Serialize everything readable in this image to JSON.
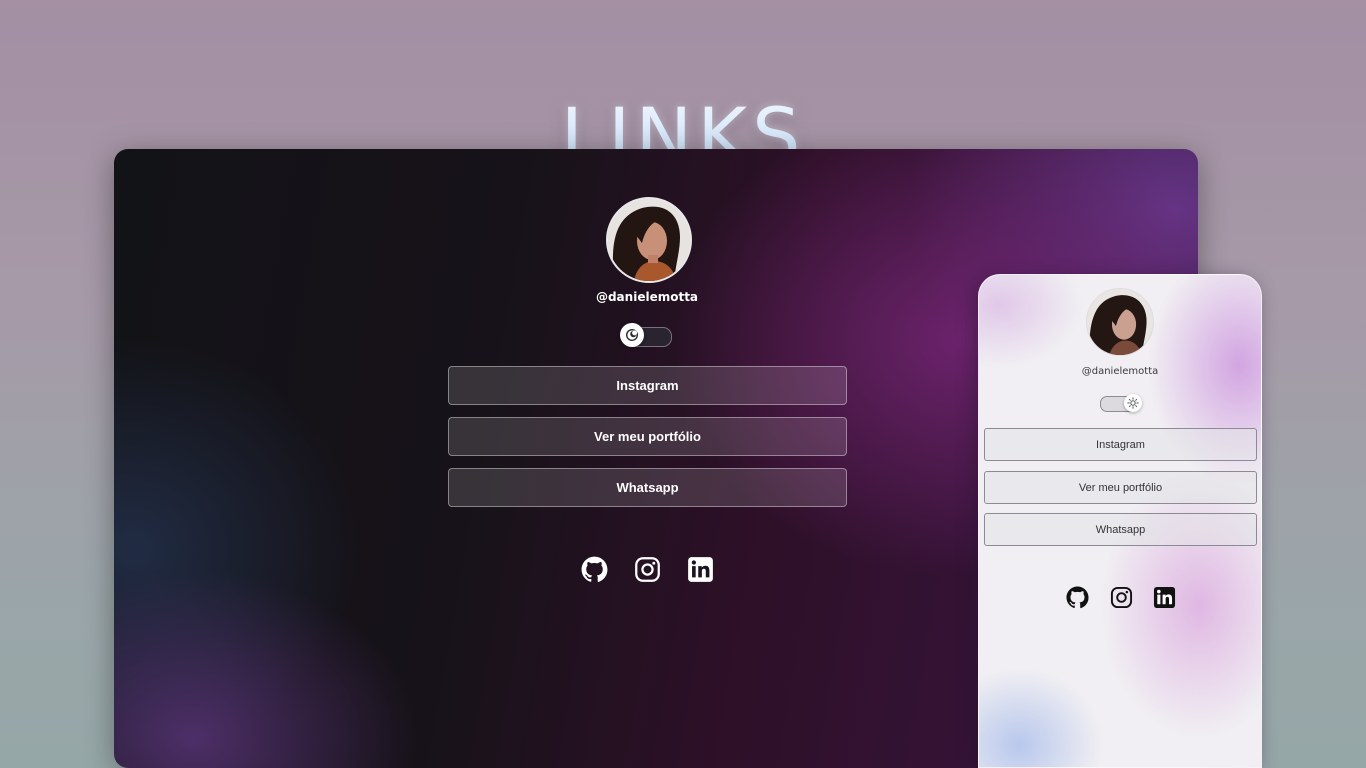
{
  "page": {
    "title": "LINKS"
  },
  "desktop": {
    "username": "@danielemotta",
    "theme_toggle": {
      "state": "dark",
      "knob_icon": "moon-icon"
    },
    "buttons": [
      {
        "label": "Instagram"
      },
      {
        "label": "Ver meu portfólio"
      },
      {
        "label": "Whatsapp"
      }
    ],
    "social_icons": [
      "github-icon",
      "instagram-icon",
      "linkedin-icon"
    ]
  },
  "mobile": {
    "username": "@danielemotta",
    "theme_toggle": {
      "state": "light",
      "knob_icon": "sun-icon"
    },
    "buttons": [
      {
        "label": "Instagram"
      },
      {
        "label": "Ver meu portfólio"
      },
      {
        "label": "Whatsapp"
      }
    ],
    "social_icons": [
      "github-icon",
      "instagram-icon",
      "linkedin-icon"
    ]
  },
  "colors": {
    "page_background": "#a69aa8",
    "title": "#dde9fb",
    "desktop_background": "#2e1028",
    "desktop_accent": "#762676",
    "mobile_background": "#f1eff3",
    "mobile_accent": "#d8a0dc"
  }
}
